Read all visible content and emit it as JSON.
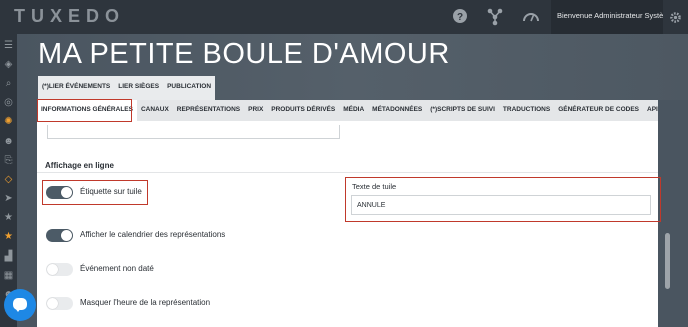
{
  "app": {
    "logo": "TUXEDO"
  },
  "topbar": {
    "user_name": "Bienvenue Administrateur Système",
    "icons": [
      "help-icon",
      "network-icon",
      "gauge-icon",
      "gear-icon"
    ]
  },
  "sidebar": {
    "icons": [
      "menu-icon",
      "tag-icon",
      "search-icon",
      "globe-icon",
      "compass-icon",
      "users-icon",
      "share-icon",
      "tags-icon",
      "send-icon",
      "star-icon",
      "star-icon",
      "chart-icon",
      "table-icon",
      "chat-icon"
    ],
    "accent": "#f0a030"
  },
  "page": {
    "title": "MA PETITE BOULE D'AMOUR"
  },
  "subtabs": [
    "(*)LIER ÉVÉNEMENTS",
    "LIER SIÈGES",
    "PUBLICATION"
  ],
  "tabs": [
    "INFORMATIONS GÉNÉRALES",
    "CANAUX",
    "REPRÉSENTATIONS",
    "PRIX",
    "PRODUITS DÉRIVÉS",
    "MÉDIA",
    "MÉTADONNÉES",
    "(*)SCRIPTS DE SUIVI",
    "TRADUCTIONS",
    "GÉNÉRATEUR DE CODES",
    "API TUXEDO"
  ],
  "active_tab": "INFORMATIONS GÉNÉRALES",
  "section": {
    "title": "Affichage en ligne",
    "toggles": [
      {
        "label": "Étiquette sur tuile",
        "on": true
      },
      {
        "label": "Afficher le calendrier des représentations",
        "on": true
      },
      {
        "label": "Événement non daté",
        "on": false
      },
      {
        "label": "Masquer l'heure de la représentation",
        "on": false
      }
    ],
    "tile_text": {
      "label": "Texte de tuile",
      "value": "ANNULÉ"
    }
  },
  "colors": {
    "highlight": "#c0392b",
    "toggle_on": "#4c5b67",
    "header_bg": "#4a5560"
  }
}
